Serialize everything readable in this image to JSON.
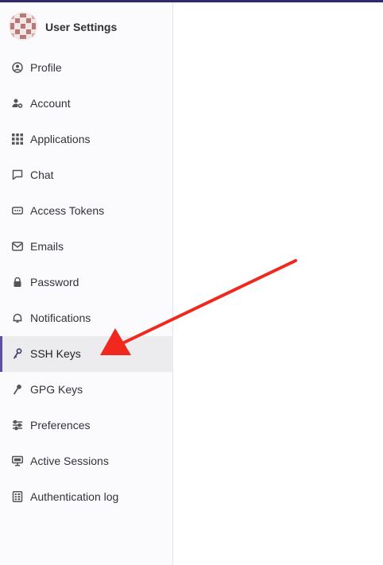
{
  "header": {
    "title": "User Settings"
  },
  "nav": {
    "items": [
      {
        "label": "Profile",
        "icon": "profile-icon"
      },
      {
        "label": "Account",
        "icon": "account-icon"
      },
      {
        "label": "Applications",
        "icon": "applications-icon"
      },
      {
        "label": "Chat",
        "icon": "chat-icon"
      },
      {
        "label": "Access Tokens",
        "icon": "token-icon"
      },
      {
        "label": "Emails",
        "icon": "email-icon"
      },
      {
        "label": "Password",
        "icon": "lock-icon"
      },
      {
        "label": "Notifications",
        "icon": "bell-icon"
      },
      {
        "label": "SSH Keys",
        "icon": "key-icon"
      },
      {
        "label": "GPG Keys",
        "icon": "key-icon"
      },
      {
        "label": "Preferences",
        "icon": "preferences-icon"
      },
      {
        "label": "Active Sessions",
        "icon": "monitor-icon"
      },
      {
        "label": "Authentication log",
        "icon": "log-icon"
      }
    ],
    "active": "SSH Keys"
  },
  "colors": {
    "topbar": "#2f2a6b",
    "active_indicator": "#5b4ea8",
    "active_background": "#ececef",
    "annotation_arrow": "#f0281e"
  }
}
